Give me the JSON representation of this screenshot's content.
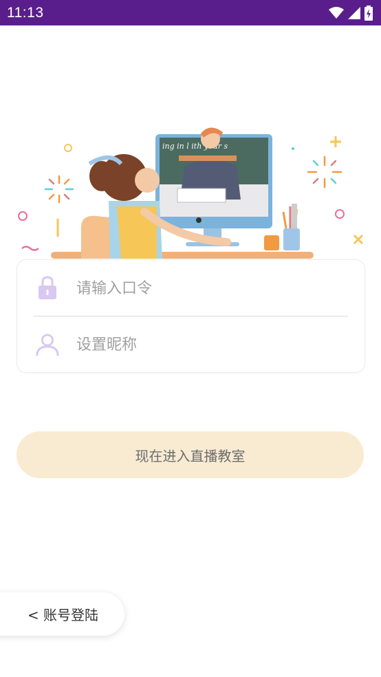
{
  "status_bar": {
    "time": "11:13",
    "icons": [
      "wifi-icon",
      "signal-icon",
      "battery-charging-icon"
    ]
  },
  "hero": {
    "illustration": "online-class-illustration",
    "chalkboard_text": "ing in l  ith your s"
  },
  "login": {
    "password_placeholder": "请输入口令",
    "nickname_placeholder": "设置昵称",
    "enter_button_label": "现在进入直播教室"
  },
  "account_login": {
    "label": "< 账号登陆"
  },
  "colors": {
    "status_bar": "#5a1e8c",
    "button_bg": "#f8ebd2",
    "icon_purple": "#d9c8f0"
  }
}
